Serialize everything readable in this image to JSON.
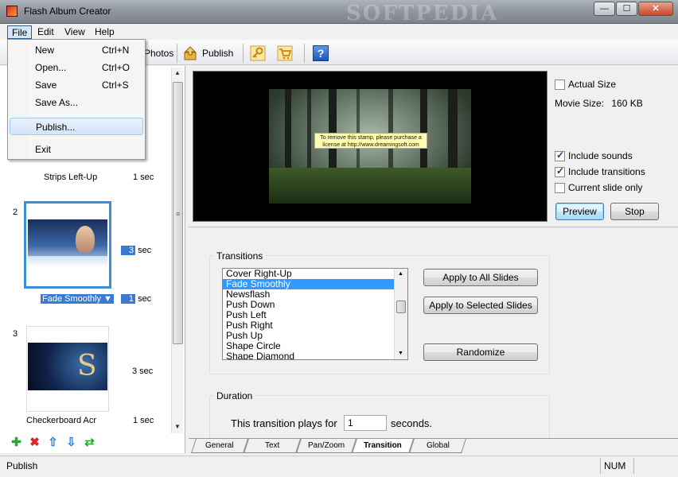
{
  "window": {
    "title": "Flash Album Creator",
    "watermark": "SOFTPEDIA",
    "buttons": {
      "minimize": "—",
      "maximize": "☐",
      "close": "✕"
    }
  },
  "menubar": {
    "items": [
      {
        "label": "File"
      },
      {
        "label": "Edit"
      },
      {
        "label": "View"
      },
      {
        "label": "Help"
      }
    ]
  },
  "toolbar": {
    "photos_label": "Photos",
    "publish_label": "Publish",
    "icons": [
      "key-icon",
      "cart-icon",
      "help-icon"
    ],
    "help_glyph": "?"
  },
  "file_menu": {
    "items": [
      {
        "label": "New",
        "shortcut": "Ctrl+N"
      },
      {
        "label": "Open...",
        "shortcut": "Ctrl+O"
      },
      {
        "label": "Save",
        "shortcut": "Ctrl+S"
      },
      {
        "label": "Save As...",
        "shortcut": ""
      },
      {
        "label": "Publish...",
        "shortcut": ""
      },
      {
        "label": "Exit",
        "shortcut": ""
      }
    ]
  },
  "slides": {
    "items": [
      {
        "transition": "Strips Left-Up",
        "transition_duration": "1 sec"
      },
      {
        "number": "2",
        "display_duration": "3",
        "display_unit": "sec",
        "transition": "Fade Smoothly",
        "transition_duration": "1",
        "transition_unit": "sec"
      },
      {
        "number": "3",
        "display_duration": "3 sec",
        "transition": "Checkerboard Acr",
        "transition_duration": "1 sec"
      }
    ],
    "dropdown_arrow": "▼",
    "scroll_grip": "≡"
  },
  "preview": {
    "stamp_text": "To remove this stamp, please purchase a license at http://www.dreamingsoft.com",
    "actual_size_label": "Actual Size",
    "movie_size_label": "Movie Size:",
    "movie_size_value": "160 KB",
    "include_sounds_label": "Include sounds",
    "include_transitions_label": "Include transitions",
    "current_slide_only_label": "Current slide only",
    "preview_button": "Preview",
    "stop_button": "Stop"
  },
  "transitions": {
    "group_label": "Transitions",
    "list": [
      "Cover Right-Up",
      "Fade Smoothly",
      "Newsflash",
      "Push Down",
      "Push Left",
      "Push Right",
      "Push Up",
      "Shape Circle",
      "Shape Diamond"
    ],
    "selected_index": 1,
    "apply_all_button": "Apply to All Slides",
    "apply_selected_button": "Apply to Selected Slides",
    "randomize_button": "Randomize"
  },
  "duration": {
    "group_label": "Duration",
    "prefix": "This transition plays for",
    "value": "1",
    "suffix": "seconds."
  },
  "tabs": [
    "General",
    "Text",
    "Pan/Zoom",
    "Transition",
    "Global"
  ],
  "active_tab": "Transition",
  "statusbar": {
    "text": "Publish",
    "num": "NUM"
  }
}
